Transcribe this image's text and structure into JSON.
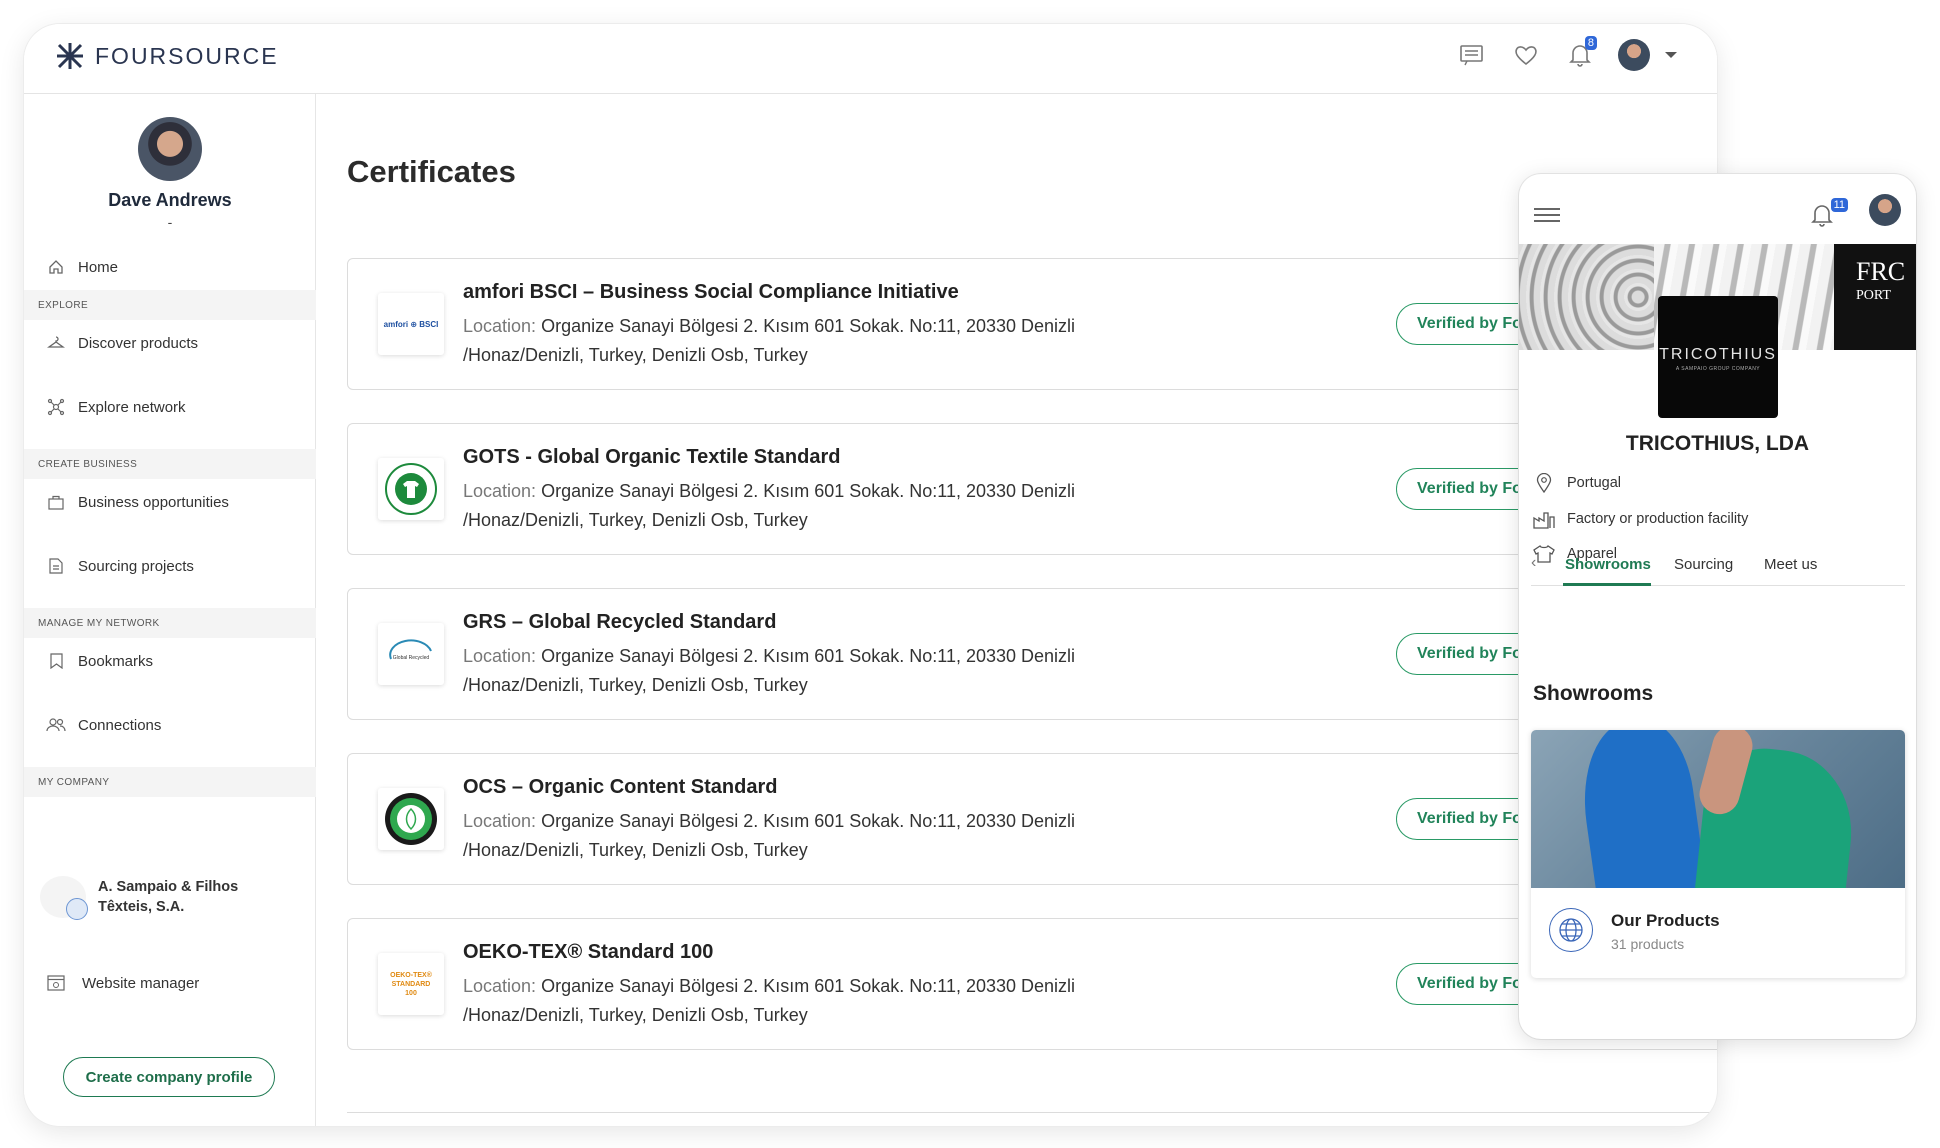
{
  "app": {
    "brand": "FOURSOURCE",
    "notifications_count": "8"
  },
  "user": {
    "name": "Dave Andrews",
    "subtitle": "-"
  },
  "sidebar": {
    "home": "Home",
    "sections": [
      "EXPLORE",
      "CREATE BUSINESS",
      "MANAGE MY NETWORK",
      "MY COMPANY"
    ],
    "items": {
      "discover": "Discover products",
      "explore": "Explore network",
      "opportunities": "Business opportunities",
      "sourcing": "Sourcing projects",
      "bookmarks": "Bookmarks",
      "connections": "Connections",
      "website": "Website manager"
    },
    "company_name": "A. Sampaio & Filhos Têxteis, S.A.",
    "create_button": "Create company profile"
  },
  "main": {
    "title": "Certificates",
    "location_label": "Location:",
    "location_value": "Organize Sanayi Bölgesi 2. Kısım 601 Sokak. No:11, 20330 Denizli /Honaz/Denizli, Turkey, Denizli Osb, Turkey",
    "verified_label": "Verified by Fo",
    "certificates": [
      {
        "title": "amfori BSCI – Business Social Compliance Initiative",
        "logo_icon": "amfori-bsci-logo",
        "logo_text": "amfori ⊕ BSCI"
      },
      {
        "title": "GOTS - Global Organic Textile Standard",
        "logo_icon": "gots-logo",
        "logo_text": "GOTS"
      },
      {
        "title": "GRS – Global Recycled Standard",
        "logo_icon": "grs-logo",
        "logo_text": "Global Recycled Standard"
      },
      {
        "title": "OCS – Organic Content Standard",
        "logo_icon": "ocs-logo",
        "logo_text": "organic 100 content standard"
      },
      {
        "title": "OEKO-TEX® Standard 100",
        "logo_icon": "oeko-tex-logo",
        "logo_text": "OEKO-TEX® STANDARD 100"
      }
    ]
  },
  "mobile": {
    "notifications_count": "11",
    "banner_text": "FRC",
    "banner_sub": "PORT",
    "logo_text": "TRICOTHIUS",
    "logo_sub": "A SAMPAIO GROUP COMPANY",
    "company_name": "TRICOTHIUS, LDA",
    "country": "Portugal",
    "type": "Factory or production facility",
    "category": "Apparel",
    "tabs": [
      "Showrooms",
      "Sourcing",
      "Meet us"
    ],
    "section_title": "Showrooms",
    "showroom_title": "Our Products",
    "showroom_count": "31 products"
  },
  "colors": {
    "accent_green": "#1f7a53",
    "badge_blue": "#2f67d8",
    "brand_navy": "#2a3550"
  }
}
